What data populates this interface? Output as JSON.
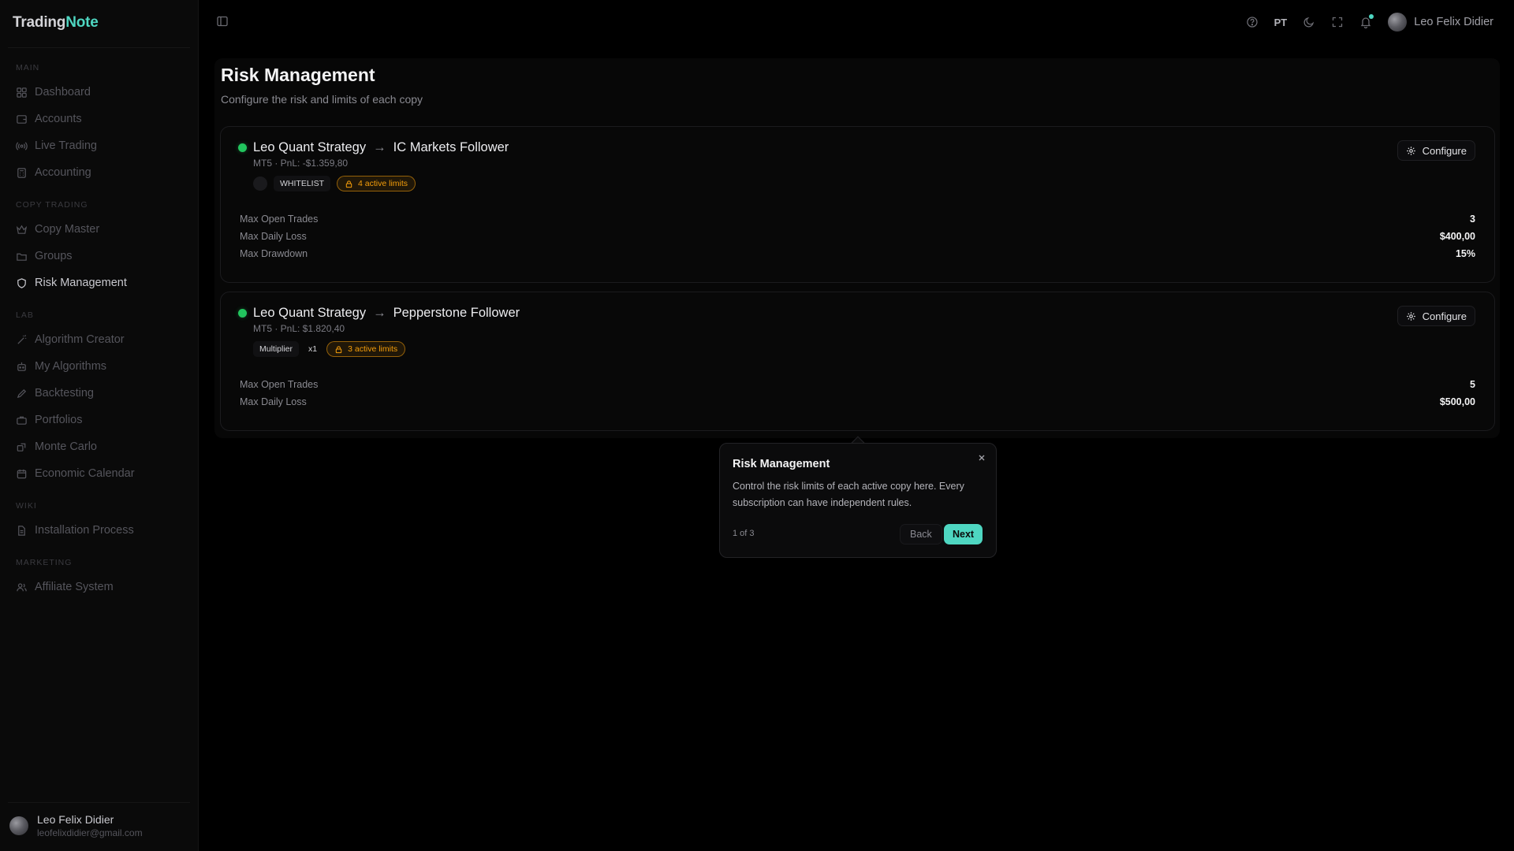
{
  "brand": {
    "part1": "Trading",
    "part2": "Note",
    "accent_color": "#4ed6c1"
  },
  "sidebar": {
    "sections": [
      {
        "label": "MAIN",
        "items": [
          {
            "label": "Dashboard",
            "icon": "grid-icon"
          },
          {
            "label": "Accounts",
            "icon": "wallet-icon"
          },
          {
            "label": "Live Trading",
            "icon": "broadcast-icon"
          },
          {
            "label": "Accounting",
            "icon": "calculator-icon"
          }
        ]
      },
      {
        "label": "COPY TRADING",
        "items": [
          {
            "label": "Copy Master",
            "icon": "crown-icon"
          },
          {
            "label": "Groups",
            "icon": "folder-icon"
          },
          {
            "label": "Risk Management",
            "icon": "shield-icon",
            "active": true
          }
        ]
      },
      {
        "label": "LAB",
        "items": [
          {
            "label": "Algorithm Creator",
            "icon": "wand-icon"
          },
          {
            "label": "My Algorithms",
            "icon": "robot-icon"
          },
          {
            "label": "Backtesting",
            "icon": "pen-icon"
          },
          {
            "label": "Portfolios",
            "icon": "briefcase-icon"
          },
          {
            "label": "Monte Carlo",
            "icon": "dice-icon"
          },
          {
            "label": "Economic Calendar",
            "icon": "calendar-icon"
          }
        ]
      },
      {
        "label": "WIKI",
        "items": [
          {
            "label": "Installation Process",
            "icon": "document-icon"
          }
        ]
      },
      {
        "label": "MARKETING",
        "items": [
          {
            "label": "Affiliate System",
            "icon": "users-icon"
          }
        ]
      }
    ],
    "user": {
      "name": "Leo Felix Didier",
      "email": "leofelixdidier@gmail.com"
    }
  },
  "topbar": {
    "language": "PT",
    "user_name": "Leo Felix Didier",
    "icons": [
      "help-icon",
      "moon-icon",
      "fullscreen-icon",
      "bell-icon"
    ]
  },
  "page": {
    "title": "Risk Management",
    "subtitle": "Configure the risk and limits of each copy"
  },
  "copies": [
    {
      "master": "Leo Quant Strategy",
      "arrow": "→",
      "follower": "IC Markets Follower",
      "meta": "MT5 · PnL: -$1.359,80",
      "tags": [
        "WHITELIST"
      ],
      "limits_badge": "4 active limits",
      "configure_label": "Configure",
      "limits": [
        {
          "label": "Max Open Trades",
          "value": "3"
        },
        {
          "label": "Max Daily Loss",
          "value": "$400,00"
        },
        {
          "label": "Max Drawdown",
          "value": "15%"
        }
      ]
    },
    {
      "master": "Leo Quant Strategy",
      "arrow": "→",
      "follower": "Pepperstone Follower",
      "meta": "MT5 · PnL: $1.820,40",
      "tags": [
        "Multiplier",
        "x1"
      ],
      "limits_badge": "3 active limits",
      "configure_label": "Configure",
      "limits": [
        {
          "label": "Max Open Trades",
          "value": "5"
        },
        {
          "label": "Max Daily Loss",
          "value": "$500,00"
        }
      ]
    }
  ],
  "tour": {
    "title": "Risk Management",
    "body": "Control the risk limits of each active copy here. Every subscription can have independent rules.",
    "step": "1 of 3",
    "back_label": "Back",
    "next_label": "Next"
  },
  "colors": {
    "status_active": "#22c55e",
    "limits_badge": "#f59e0b",
    "next_button": "#4ed6c1"
  }
}
